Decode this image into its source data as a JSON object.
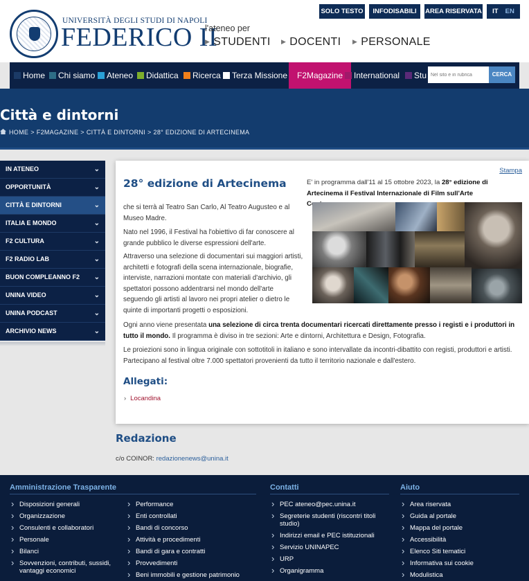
{
  "header": {
    "logo_top": "UNIVERSITÀ DEGLI STUDI DI NAPOLI",
    "logo_main": "FEDERICO II",
    "ateneo_per": "l'ateneo per",
    "audiences": [
      "STUDENTI",
      "DOCENTI",
      "PERSONALE"
    ],
    "utility": [
      "SOLO TESTO",
      "INFODISABILI",
      "AREA RISERVATA"
    ],
    "languages": [
      "IT",
      "EN"
    ]
  },
  "nav": {
    "items": [
      {
        "label": "Home",
        "color": "#1b3a66"
      },
      {
        "label": "Chi siamo",
        "color": "#2e6d86"
      },
      {
        "label": "Ateneo",
        "color": "#2aa0d6"
      },
      {
        "label": "Didattica",
        "color": "#7dae2c"
      },
      {
        "label": "Ricerca",
        "color": "#f07f1b"
      },
      {
        "label": "Terza Missione",
        "color": "#ffffff"
      },
      {
        "label": "F2Magazine",
        "color": "#c1126f"
      },
      {
        "label": "International",
        "color": "#a0196a"
      },
      {
        "label": "Stu",
        "color": "#5a2a78"
      }
    ],
    "search_placeholder": "Nel sito e in rubrica",
    "search_button": "CERCA"
  },
  "banner": {
    "title": "Città e dintorni",
    "breadcrumb": [
      "HOME",
      "F2MAGAZINE",
      "CITTÀ E DINTORNI",
      "28° EDIZIONE DI ARTECINEMA"
    ]
  },
  "sidebar": {
    "items": [
      "IN ATENEO",
      "OPPORTUNITÀ",
      "CITTÀ E DINTORNI",
      "ITALIA E MONDO",
      "F2 CULTURA",
      "F2 RADIO LAB",
      "BUON COMPLEANNO F2",
      "UNINA VIDEO",
      "UNINA PODCAST",
      "ARCHIVIO NEWS"
    ],
    "active_index": 2
  },
  "article": {
    "print_label": "Stampa",
    "title": "28° edizione di Artecinema",
    "intro_line1": "E' in programma dall'11 al 15 ottobre 2023, la ",
    "intro_bold1": "28° edizione di",
    "intro_bold2": "Artecinema il Festival Internazionale di Film sull'Arte Contemporanea",
    "intro_end": ",",
    "p1": "che si terrà al Teatro San Carlo, Al Teatro Augusteo e al Museo Madre.",
    "p2": "Nato nel 1996, il Festival ha l'obiettivo di far conoscere al grande pubblico le diverse espressioni dell'arte.",
    "p3": "Attraverso una selezione di documentari sui maggiori artisti, architetti e fotografi della scena internazionale, biografie, interviste, narrazioni montate con materiali d'archivio, gli spettatori possono addentrarsi nel mondo dell'arte seguendo gli artisti al lavoro nei propri atelier o dietro le quinte di importanti progetti o esposizioni.",
    "p4_pre": "Ogni anno viene presentata ",
    "p4_bold": "una selezione di circa trenta documentari ricercati direttamente presso i registi e i produttori in tutto il mondo.",
    "p4_post": " Il programma è diviso in tre sezioni: Arte e dintorni, Architettura e Design, Fotografia.",
    "p5": "Le proiezioni sono in lingua originale con sottotitoli in italiano e sono intervallate da incontri-dibattito con registi, produttori e artisti. Partecipano al festival oltre 7.000 spettatori provenienti da tutto il territorio nazionale e dall'estero.",
    "attachments_title": "Allegati:",
    "attachments": [
      "Locandina"
    ]
  },
  "redazione": {
    "title": "Redazione",
    "prefix": "c/o COINOR: ",
    "email": "redazionenews@unina.it"
  },
  "footer": {
    "amministrazione": {
      "title": "Amministrazione Trasparente",
      "col1": [
        "Disposizioni generali",
        "Organizzazione",
        "Consulenti e collaboratori",
        "Personale",
        "Bilanci",
        "Sovvenzioni, contributi, sussidi, vantaggi economici"
      ],
      "col2": [
        "Performance",
        "Enti controllati",
        "Bandi di concorso",
        "Attività e procedimenti",
        "Bandi di gara e contratti",
        "Provvedimenti",
        "Beni immobili e gestione patrimonio"
      ]
    },
    "contatti": {
      "title": "Contatti",
      "items": [
        "PEC ateneo@pec.unina.it",
        "Segreterie studenti (riscontri titoli studio)",
        "Indirizzi email e PEC istituzionali",
        "Servizio UNINAPEC",
        "URP",
        "Organigramma"
      ]
    },
    "aiuto": {
      "title": "Aiuto",
      "items": [
        "Area riservata",
        "Guida al portale",
        "Mappa del portale",
        "Accessibilità",
        "Elenco Siti tematici",
        "Informativa sui cookie",
        "Modulistica"
      ]
    }
  }
}
